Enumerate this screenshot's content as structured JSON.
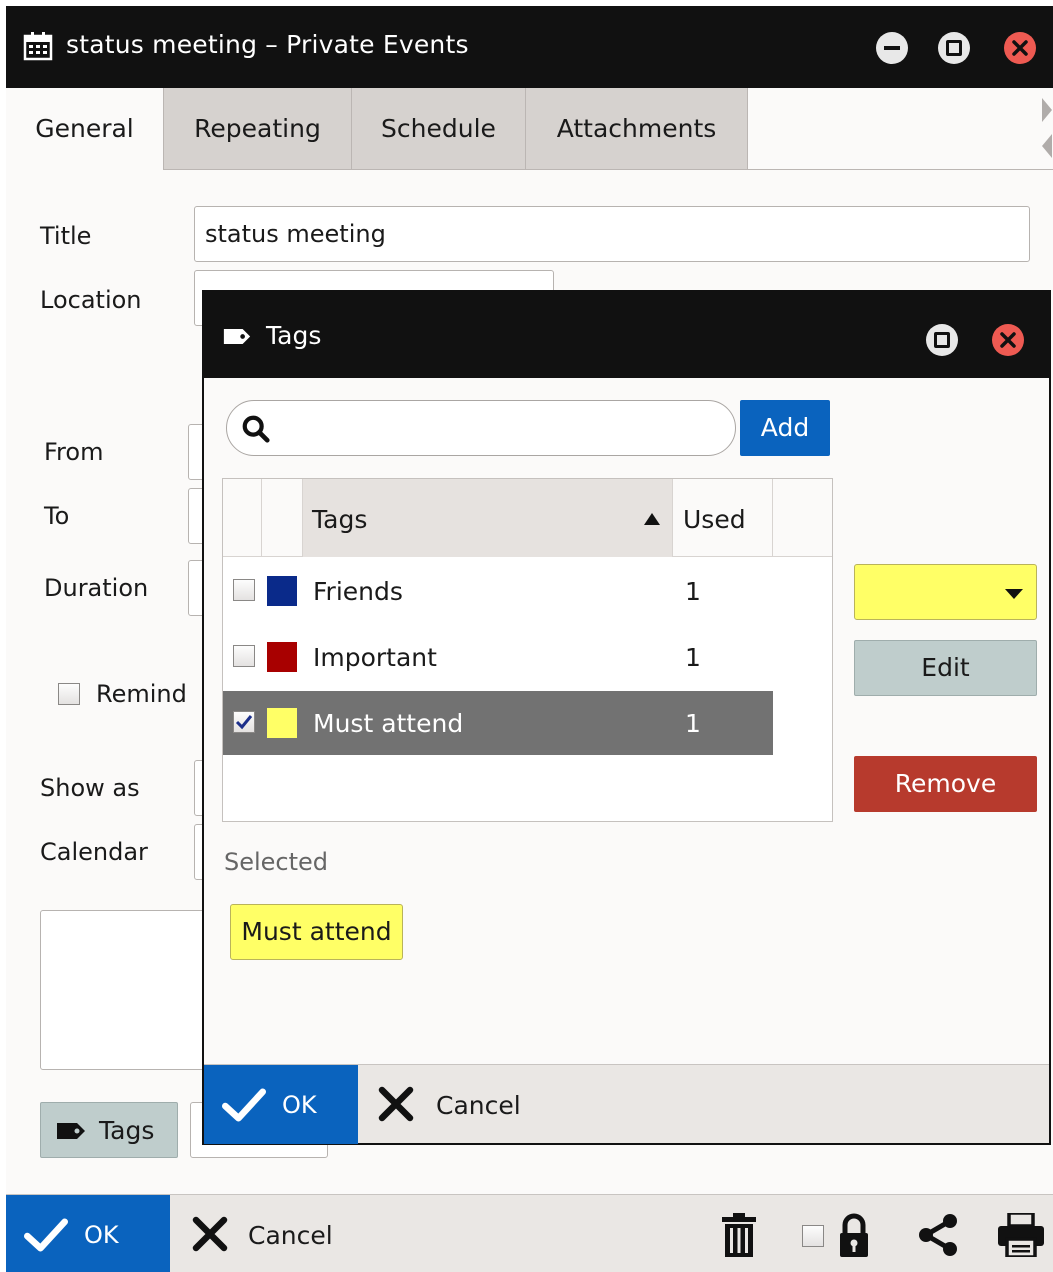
{
  "window": {
    "title": "status meeting – Private Events",
    "icon": "calendar-icon"
  },
  "tabs": [
    {
      "label": "General",
      "active": true
    },
    {
      "label": "Repeating",
      "active": false
    },
    {
      "label": "Schedule",
      "active": false
    },
    {
      "label": "Attachments",
      "active": false
    }
  ],
  "form": {
    "title_label": "Title",
    "title_value": "status meeting",
    "location_label": "Location",
    "from_label": "From",
    "to_label": "To",
    "duration_label": "Duration",
    "remind_label": "Remind",
    "show_as_label": "Show as",
    "calendar_label": "Calendar",
    "tags_button": "Tags"
  },
  "bottom_bar": {
    "ok": "OK",
    "cancel": "Cancel"
  },
  "tags_dialog": {
    "title": "Tags",
    "search_placeholder": "",
    "add": "Add",
    "columns": {
      "tags": "Tags",
      "used": "Used"
    },
    "rows": [
      {
        "name": "Friends",
        "used": "1",
        "color": "#0a2a8a",
        "checked": false
      },
      {
        "name": "Important",
        "used": "1",
        "color": "#a80000",
        "checked": false
      },
      {
        "name": "Must attend",
        "used": "1",
        "color": "#ffff66",
        "checked": true
      }
    ],
    "selected_color": "#ffff66",
    "edit": "Edit",
    "remove": "Remove",
    "selected_label": "Selected",
    "selected_chip": "Must attend",
    "ok": "OK",
    "cancel": "Cancel"
  },
  "colors": {
    "accent_blue": "#0a63be",
    "remove_red": "#b73a2d",
    "titlebar": "#111111"
  }
}
